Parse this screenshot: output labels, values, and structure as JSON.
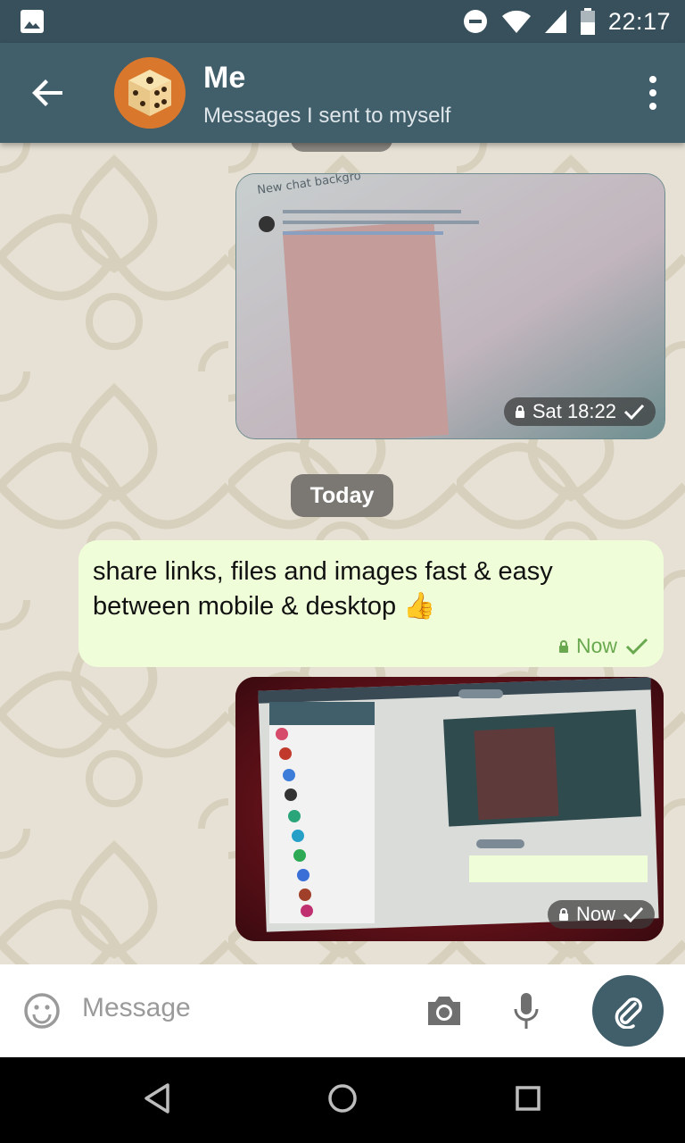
{
  "status_bar": {
    "time": "22:17"
  },
  "app_bar": {
    "title": "Me",
    "subtitle": "Messages I sent to myself"
  },
  "messages": [
    {
      "type": "image",
      "time": "Sat 18:22",
      "status": "read"
    },
    {
      "type": "day_separator",
      "label": "Today"
    },
    {
      "type": "text",
      "text": "share links, files and images fast & easy between mobile & desktop 👍",
      "time": "Now",
      "status": "sent"
    },
    {
      "type": "image",
      "time": "Now",
      "status": "sent"
    }
  ],
  "composer": {
    "placeholder": "Message"
  },
  "colors": {
    "toolbar": "#415e6b",
    "status_bar": "#37505c",
    "outgoing_bubble": "#effed9",
    "check_green": "#6aa84f"
  }
}
